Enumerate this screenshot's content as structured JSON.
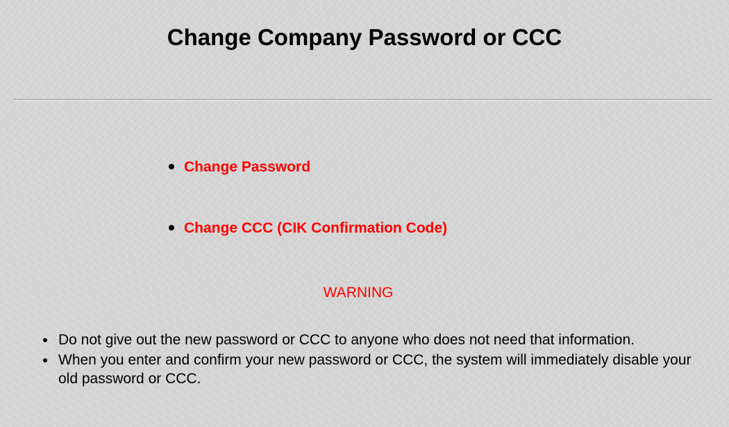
{
  "page": {
    "title": "Change Company Password or CCC"
  },
  "actions": {
    "items": [
      {
        "label": "Change Password"
      },
      {
        "label": "Change CCC (CIK Confirmation Code)"
      }
    ]
  },
  "warning": {
    "heading": "WARNING",
    "items": [
      {
        "text": "Do not give out the new password or CCC to anyone who does not need that information."
      },
      {
        "text": "When you enter and confirm your new password or CCC, the system will immediately disable your old password or CCC."
      }
    ]
  },
  "colors": {
    "background": "#d4d4d4",
    "link": "#ff0000",
    "warning": "#ff0000",
    "text": "#000000"
  },
  "icons": {
    "list_bullet": "bullet-icon"
  }
}
